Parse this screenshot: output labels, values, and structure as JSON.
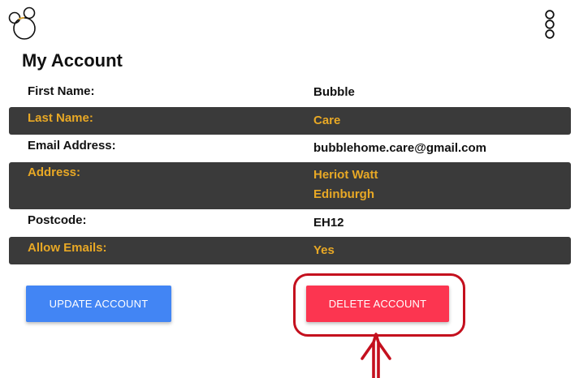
{
  "header": {
    "logo_icon": "bubbles-logo-icon",
    "menu_icon": "kebab-menu-icon"
  },
  "page": {
    "title": "My Account"
  },
  "fields": [
    {
      "label": "First Name:",
      "value": "Bubble"
    },
    {
      "label": "Last Name:",
      "value": "Care"
    },
    {
      "label": "Email Address:",
      "value": "bubblehome.care@gmail.com"
    },
    {
      "label": "Address:",
      "value_line1": "Heriot Watt",
      "value_line2": "Edinburgh"
    },
    {
      "label": "Postcode:",
      "value": "EH12"
    },
    {
      "label": "Allow Emails:",
      "value": "Yes"
    }
  ],
  "actions": {
    "update_label": "UPDATE ACCOUNT",
    "delete_label": "DELETE ACCOUNT"
  },
  "colors": {
    "accent_text": "#e8a825",
    "dark_row_bg": "#3a3a3a",
    "update_button": "#4285f4",
    "delete_button": "#fc3550",
    "annotation": "#c4101e"
  }
}
